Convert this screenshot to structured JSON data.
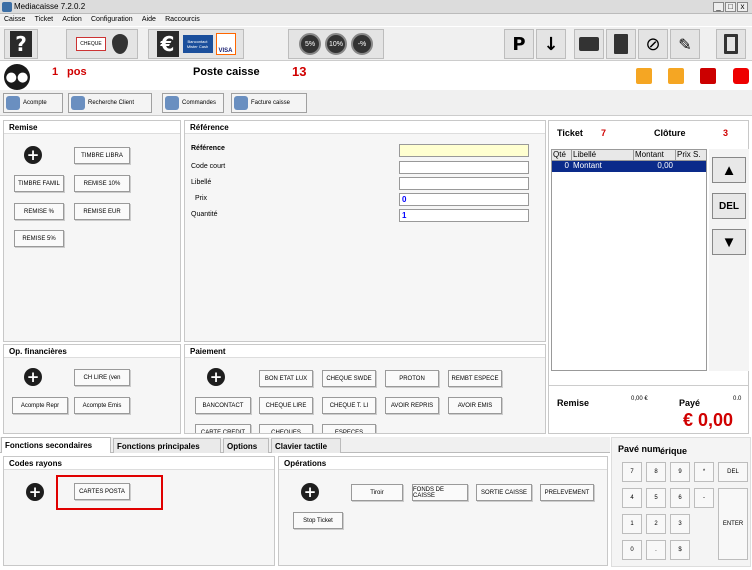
{
  "window": {
    "title": "Mediacaisse 7.2.0.2",
    "min": "_",
    "max": "□",
    "close": "x"
  },
  "menu": [
    "Caisse",
    "Ticket",
    "Action",
    "Configuration",
    "Aide",
    "Raccourcis"
  ],
  "toolbar": {
    "help": "?",
    "cheque": "CHEQUE",
    "euro": "€",
    "bancontact": "Bancontact Mister Cash",
    "visa": "VISA",
    "pct5": "5%",
    "pct10": "10%",
    "minus_pct": "-%",
    "p": "P"
  },
  "info": {
    "pos_num": "1",
    "pos_label": "pos",
    "station": "Poste caisse",
    "count": "13"
  },
  "actions": [
    "Acompte",
    "Recherche Client",
    "Commandes",
    "Facture caisse"
  ],
  "remise": {
    "title": "Remise",
    "buttons": [
      "TIMBRE LIBRA",
      "TIMBRE FAMIL",
      "REMISE 10%",
      "REMISE %",
      "REMISE EUR",
      "REMISE 5%"
    ]
  },
  "reference": {
    "title": "Référence",
    "labels": {
      "ref": "Référence",
      "code": "Code court",
      "libelle": "Libellé",
      "prix": "Prix",
      "qte": "Quantité"
    },
    "values": {
      "ref": "",
      "code": "",
      "libelle": "",
      "prix": "0",
      "qte": "1"
    }
  },
  "ticket": {
    "label": "Ticket",
    "number": "7",
    "cloture_label": "Clôture",
    "cloture_number": "3",
    "columns": [
      "Qté",
      "Libellé",
      "Montant",
      "Prix S."
    ],
    "rows": [
      {
        "qty": "0",
        "label": "Montant",
        "amount": "0,00",
        "price": ""
      }
    ],
    "del": "DEL"
  },
  "totals": {
    "remise_label": "Remise",
    "remise_value": "0,00 €",
    "paye_label": "Payé",
    "paye_value": "0.0",
    "total": "€ 0,00"
  },
  "op_fin": {
    "title": "Op. financières",
    "buttons": [
      "CH LIRE (ven",
      "Acompte Repr",
      "Acompte Emis"
    ]
  },
  "paiement": {
    "title": "Paiement",
    "buttons": [
      "BON ETAT LUX",
      "CHEQUE SWDE",
      "PROTON",
      "REMBT ESPECE",
      "BANCONTACT",
      "CHEQUE LIRE",
      "CHEQUE T. LI",
      "AVOIR REPRIS",
      "AVOIR EMIS",
      "CARTE CREDIT",
      "CHEQUES",
      "ESPECES"
    ]
  },
  "tabs": [
    "Fonctions secondaires",
    "Fonctions principales",
    "Options",
    "Clavier tactile"
  ],
  "codes_rayons": {
    "title": "Codes rayons",
    "buttons": [
      "CARTES POSTA"
    ]
  },
  "operations": {
    "title": "Opérations",
    "buttons": [
      "Tiroir",
      "FONDS DE CAISSE",
      "SORTIE CAISSE",
      "PRELEVEMENT",
      "Stop Ticket"
    ]
  },
  "pave": {
    "title_a": "Pavé num",
    "title_b": "érique",
    "keys": [
      "7",
      "8",
      "9",
      "*",
      "4",
      "5",
      "6",
      "-",
      "1",
      "2",
      "3",
      "0",
      ".",
      "$"
    ],
    "del": "DEL",
    "enter": "ENTER"
  },
  "colors": {
    "accent_red": "#d00000",
    "highlight": "#e00000",
    "selection": "#0a2a8a",
    "orange": "#f5a623"
  }
}
